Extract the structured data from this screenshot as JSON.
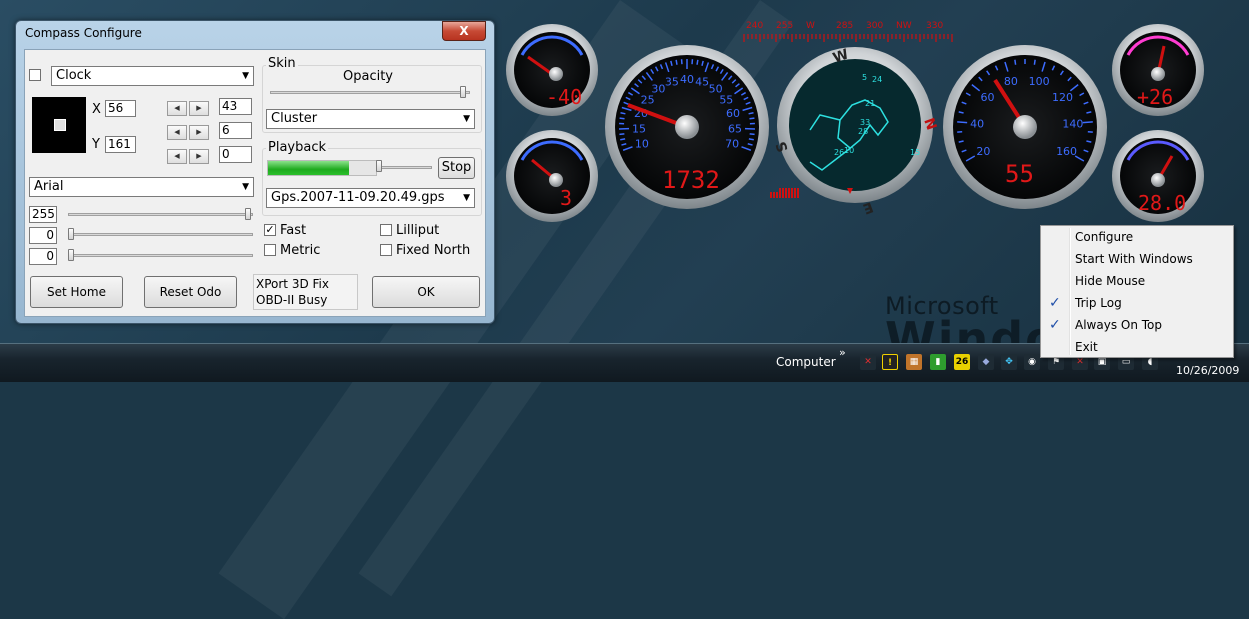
{
  "dialog": {
    "title": "Compass Configure",
    "close_glyph": "X",
    "element_select": "Clock",
    "x_label": "X",
    "x_value": "56",
    "y_label": "Y",
    "y_value": "161",
    "spin_values": [
      "43",
      "6",
      "0"
    ],
    "font_select": "Arial",
    "slider_values": [
      "255",
      "0",
      "0"
    ],
    "skin": {
      "label": "Skin",
      "opacity_label": "Opacity",
      "skin_select": "Cluster"
    },
    "playback": {
      "label": "Playback",
      "stop_label": "Stop",
      "file_select": "Gps.2007-11-09.20.49.gps",
      "progress_fraction": 0.75
    },
    "options": {
      "fast_label": "Fast",
      "fast_checked": true,
      "metric_label": "Metric",
      "metric_checked": false,
      "lilliput_label": "Lilliput",
      "lilliput_checked": false,
      "fixed_north_label": "Fixed North",
      "fixed_north_checked": false
    },
    "set_home_label": "Set Home",
    "reset_odo_label": "Reset Odo",
    "status_line1": "XPort 3D Fix",
    "status_line2": "OBD-II Busy",
    "ok_label": "OK"
  },
  "gauges": {
    "top_left_readout": "-40",
    "bottom_left_readout": "3",
    "rpm_readout": "1732",
    "speed_readout": "55",
    "top_right_readout": "+26",
    "bottom_right_readout": "28.0",
    "compass_letters": [
      "W",
      "N",
      "E",
      "S"
    ],
    "compass_marks": [
      "5",
      "24",
      "21",
      "33",
      "28",
      "26",
      "10",
      "15"
    ],
    "top_scale_labels": [
      "240",
      "255",
      "W",
      "285",
      "300",
      "NW",
      "330"
    ],
    "rpm_scale": [
      "10",
      "15",
      "20",
      "25",
      "30",
      "35",
      "40",
      "45",
      "50",
      "55",
      "60",
      "65",
      "70"
    ],
    "speed_scale": [
      "20",
      "40",
      "60",
      "80",
      "100",
      "120",
      "140",
      "160"
    ]
  },
  "taskbar": {
    "toolbar_label": "Computer",
    "chevron": "»",
    "date": "10/26/2009"
  },
  "context_menu": {
    "items": [
      {
        "label": "Configure",
        "checked": false
      },
      {
        "label": "Start With Windows",
        "checked": false
      },
      {
        "label": "Hide Mouse",
        "checked": false
      },
      {
        "label": "Trip Log",
        "checked": true
      },
      {
        "label": "Always On Top",
        "checked": true
      },
      {
        "label": "Exit",
        "checked": false
      }
    ]
  },
  "desktop": {
    "brand_top": "Microsoft",
    "brand_bottom": "Windows"
  },
  "colors": {
    "gauge_needle": "#d01010",
    "readout_red": "#e01818",
    "rpm_scale_blue": "#3d6cff",
    "pink_scale": "#ff3cd2",
    "gps_trace": "#2de0e0",
    "check_blue": "#1e4ea8"
  }
}
